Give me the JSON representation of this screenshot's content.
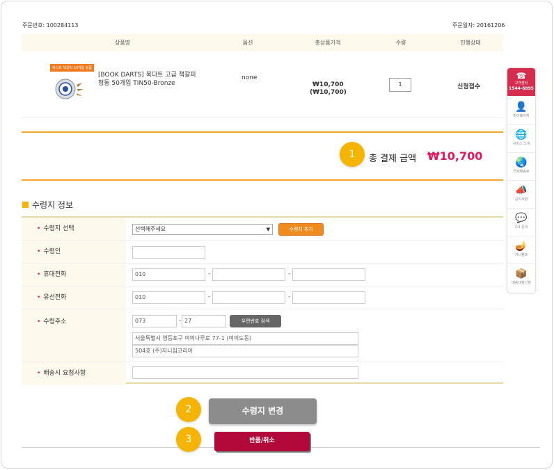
{
  "order": {
    "number_label": "주문번호: 100284113",
    "date_label": "주문일자: 20161206"
  },
  "table": {
    "headers": [
      "상품명",
      "옵션",
      "총상품가격",
      "수량",
      "진행상태"
    ],
    "rows": [
      {
        "badge": "북다트 책갈피 50개입 정품",
        "name_line1": "[BOOK DARTS] 북다트 고급 책갈피",
        "name_line2": "청동 50개입 TIN50-Bronze",
        "option": "none",
        "price": "₩10,700",
        "price_sub": "(₩10,700)",
        "quantity": "1",
        "status": "신청접수"
      }
    ]
  },
  "total": {
    "label": "총 결제 금액",
    "value": "₩10,700"
  },
  "callouts": [
    "1",
    "2",
    "3"
  ],
  "recipient": {
    "title": "수령지 정보",
    "fields": {
      "select": {
        "label": "수령지 선택",
        "value": "선택해주세요",
        "add_button": "수령지 추가"
      },
      "name": {
        "label": "수령인",
        "value": ""
      },
      "mobile": {
        "label": "휴대전화",
        "p1": "010",
        "p2": "",
        "p3": ""
      },
      "phone": {
        "label": "유선전화",
        "p1": "010",
        "p2": "",
        "p3": ""
      },
      "address": {
        "label": "수령주소",
        "zip1": "073",
        "zip2": "27",
        "search_button": "우편번호 검색",
        "line1": "서울특별시 영등포구 여의나루로 77-1 (여의도동)",
        "line2": "504호 (주)지니집코리아"
      },
      "memo": {
        "label": "배송시 요청사항",
        "value": ""
      }
    }
  },
  "buttons": {
    "change": "수령지 변경",
    "return": "반품/취소"
  },
  "sidebar": {
    "top": {
      "icon": "phone-icon",
      "line1": "고객센터",
      "line2": "1544-6895"
    },
    "items": [
      {
        "icon": "user-icon",
        "glyph": "👤",
        "label": "마이페이지"
      },
      {
        "icon": "globe-icon",
        "glyph": "🌐",
        "label": "서비스 소개"
      },
      {
        "icon": "globe-ship-icon",
        "glyph": "🌏",
        "label": "국제배송료"
      },
      {
        "icon": "megaphone-icon",
        "glyph": "📣",
        "label": "공지사항"
      },
      {
        "icon": "chat-icon",
        "glyph": "💬",
        "label": "1:1 문의"
      },
      {
        "icon": "lamp-icon",
        "glyph": "🪔",
        "label": "지니램프"
      },
      {
        "icon": "box-icon",
        "glyph": "📦",
        "label": "배송대행신청"
      }
    ]
  }
}
